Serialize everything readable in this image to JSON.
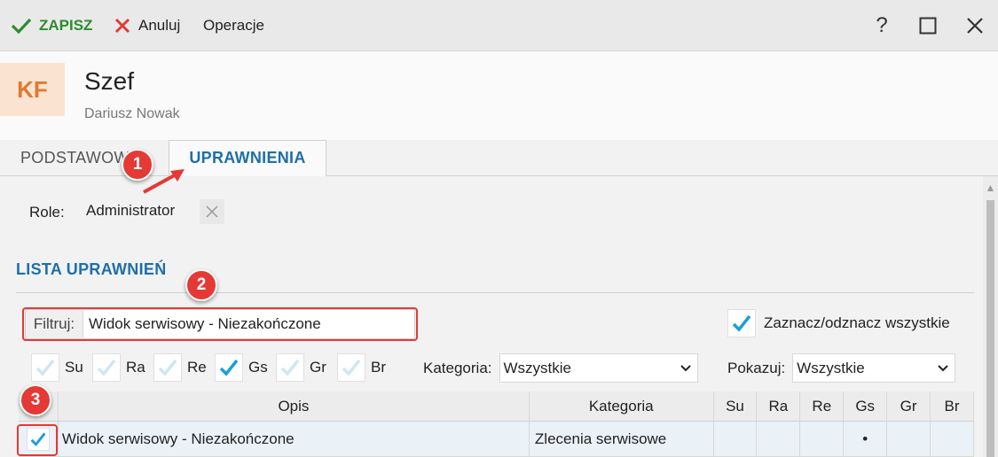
{
  "toolbar": {
    "save_label": "ZAPISZ",
    "cancel_label": "Anuluj",
    "operations_label": "Operacje",
    "help_label": "?",
    "close_label": "✕"
  },
  "header": {
    "avatar_initials": "KF",
    "title": "Szef",
    "subtitle": "Dariusz Nowak"
  },
  "tabs": [
    {
      "label": "PODSTAWOWE",
      "active": false
    },
    {
      "label": "UPRAWNIENIA",
      "active": true
    }
  ],
  "roles": {
    "label": "Role:",
    "items": [
      "Administrator"
    ]
  },
  "permissions": {
    "section_title": "LISTA UPRAWNIEŃ",
    "filter_label": "Filtruj:",
    "filter_value": "Widok serwisowy - Niezakończone",
    "select_all_label": "Zaznacz/odznacz wszystkie",
    "select_all_checked": true,
    "types": [
      {
        "code": "Su",
        "checked": false
      },
      {
        "code": "Ra",
        "checked": false
      },
      {
        "code": "Re",
        "checked": false
      },
      {
        "code": "Gs",
        "checked": true
      },
      {
        "code": "Gr",
        "checked": false
      },
      {
        "code": "Br",
        "checked": false
      }
    ],
    "category_label": "Kategoria:",
    "category_value": "Wszystkie",
    "show_label": "Pokazuj:",
    "show_value": "Wszystkie"
  },
  "grid": {
    "columns": [
      "Opis",
      "Kategoria",
      "Su",
      "Ra",
      "Re",
      "Gs",
      "Gr",
      "Br"
    ],
    "rows": [
      {
        "checked": true,
        "opis": "Widok serwisowy - Niezakończone",
        "kategoria": "Zlecenia serwisowe",
        "su": "",
        "ra": "",
        "re": "",
        "gs": "•",
        "gr": "",
        "br": ""
      }
    ]
  },
  "annotations": [
    "1",
    "2",
    "3"
  ],
  "colors": {
    "accent": "#1e6fa8",
    "save": "#2e8b2e",
    "cancel": "#e53935",
    "check": "#1a9fd8",
    "annotation": "#e53935"
  }
}
